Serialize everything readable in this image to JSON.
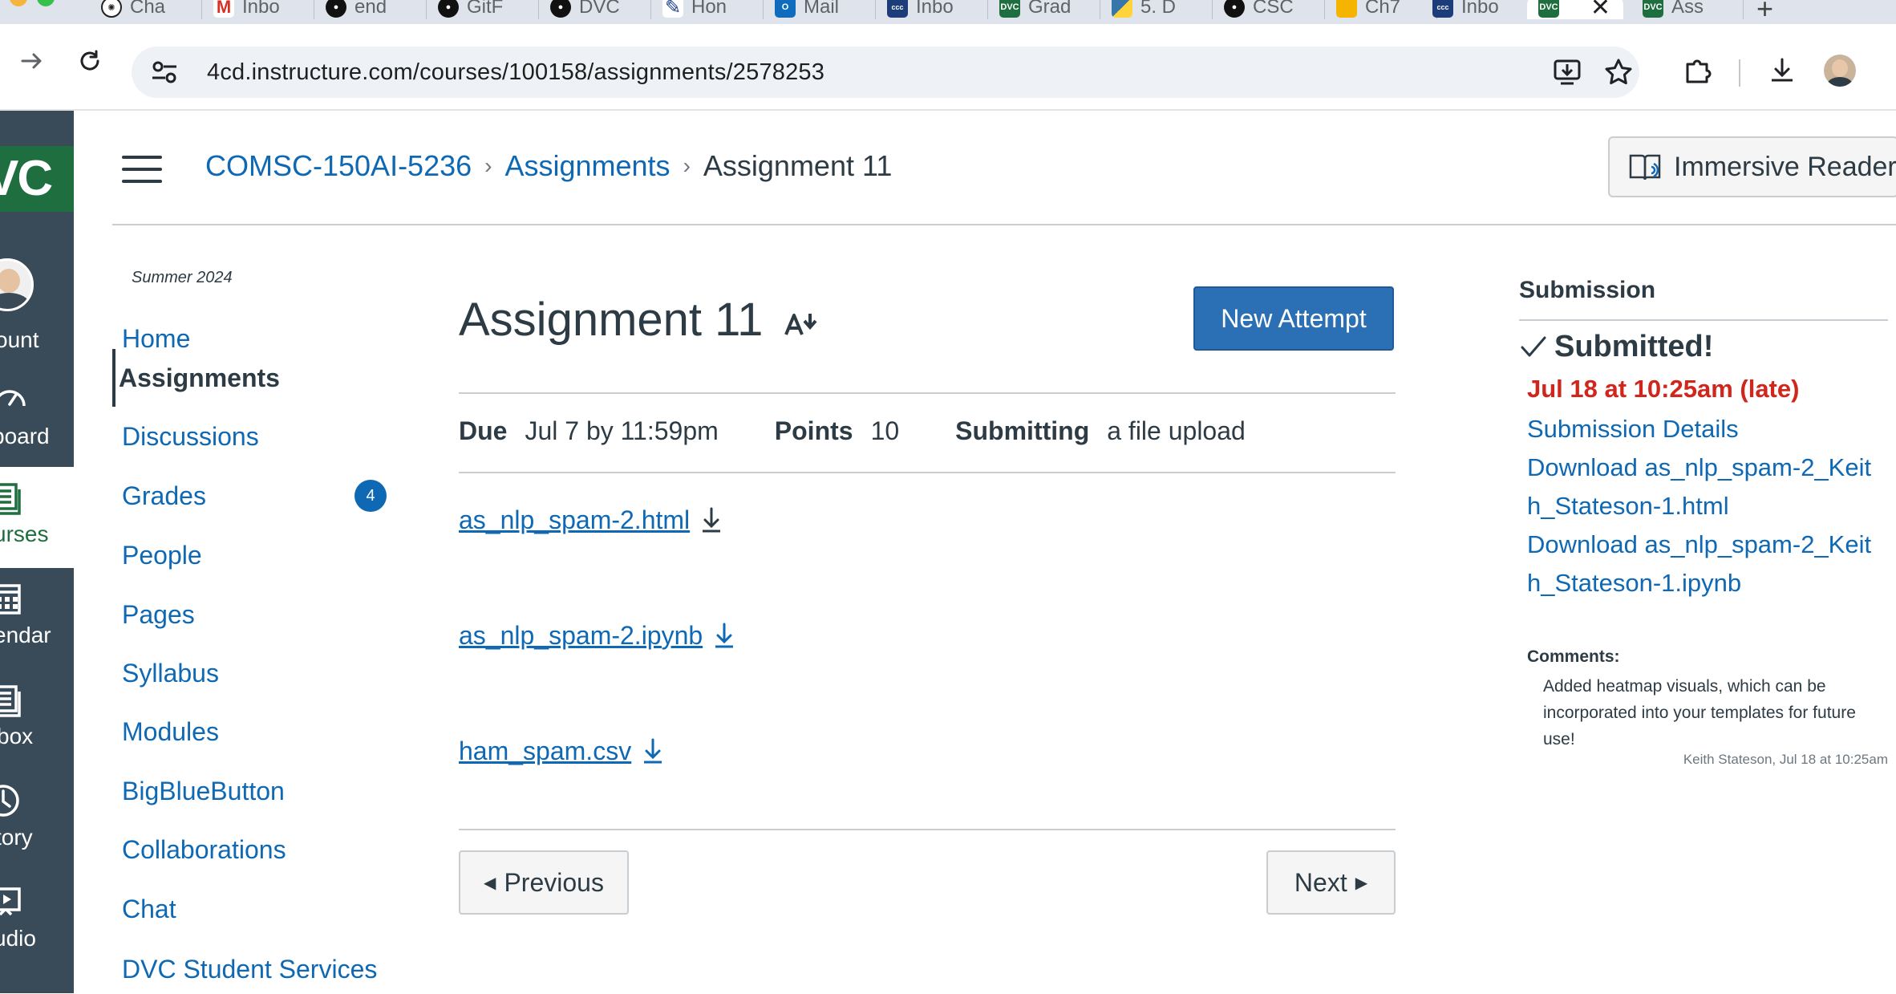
{
  "browser": {
    "tabs": [
      {
        "label": "Cha",
        "icon": "openai-icon"
      },
      {
        "label": "Inbo",
        "icon": "gmail-icon"
      },
      {
        "label": "end",
        "icon": "github-icon"
      },
      {
        "label": "GitF",
        "icon": "github-icon"
      },
      {
        "label": "DVC",
        "icon": "github-icon"
      },
      {
        "label": "Hon",
        "icon": "canvas-pen-icon"
      },
      {
        "label": "Mail",
        "icon": "outlook-icon"
      },
      {
        "label": "Inbo",
        "icon": "ccc-icon"
      },
      {
        "label": "Grad",
        "icon": "dvc-icon"
      },
      {
        "label": "5. D",
        "icon": "python-icon"
      },
      {
        "label": "CSC",
        "icon": "github-icon"
      },
      {
        "label": "Ch7",
        "icon": "slides-icon"
      },
      {
        "label": "Inbo",
        "icon": "ccc-icon"
      },
      {
        "label": "",
        "icon": "dvc-icon"
      },
      {
        "label": "Ass",
        "icon": "dvc-icon"
      }
    ],
    "url": "4cd.instructure.com/courses/100158/assignments/2578253"
  },
  "global_nav": {
    "logo_text": "VC",
    "items": [
      {
        "label": "ount",
        "icon": "avatar-icon"
      },
      {
        "label": "board",
        "icon": "dashboard-icon"
      },
      {
        "label": "urses",
        "icon": "courses-icon"
      },
      {
        "label": "endar",
        "icon": "calendar-icon"
      },
      {
        "label": "box",
        "icon": "inbox-icon"
      },
      {
        "label": "tory",
        "icon": "history-icon"
      },
      {
        "label": "udio",
        "icon": "studio-icon"
      }
    ]
  },
  "breadcrumbs": {
    "course": "COMSC-150AI-5236",
    "section": "Assignments",
    "current": "Assignment 11"
  },
  "immersive_reader_label": "Immersive Reader",
  "course_nav": {
    "term": "Summer 2024",
    "items": [
      {
        "label": "Home"
      },
      {
        "label": "Assignments"
      },
      {
        "label": "Discussions"
      },
      {
        "label": "Grades",
        "badge": "4"
      },
      {
        "label": "People"
      },
      {
        "label": "Pages"
      },
      {
        "label": "Syllabus"
      },
      {
        "label": "Modules"
      },
      {
        "label": "BigBlueButton"
      },
      {
        "label": "Collaborations"
      },
      {
        "label": "Chat"
      },
      {
        "label": "DVC Student Services"
      }
    ]
  },
  "assignment": {
    "title": "Assignment 11",
    "new_attempt_label": "New Attempt",
    "due_label": "Due",
    "due_value": "Jul 7 by 11:59pm",
    "points_label": "Points",
    "points_value": "10",
    "submitting_label": "Submitting",
    "submitting_value": "a file upload",
    "files": [
      "as_nlp_spam-2.html",
      "as_nlp_spam-2.ipynb",
      "ham_spam.csv"
    ],
    "previous_label": "Previous",
    "next_label": "Next"
  },
  "submission": {
    "heading": "Submission",
    "status": "Submitted!",
    "submitted_at": "Jul 18 at 10:25am (late)",
    "details_link": "Submission Details",
    "download_1": "Download as_nlp_spam-2_Keith_Stateson-1.html",
    "download_2": "Download as_nlp_spam-2_Keith_Stateson-1.ipynb",
    "comments_label": "Comments:",
    "comment_text": "Added heatmap visuals, which can be incorporated into your templates for future use!",
    "comment_meta": "Keith Stateson, Jul 18 at 10:25am"
  },
  "colors": {
    "brand_green": "#1e6e3f",
    "nav_dark": "#394b58",
    "link_blue": "#0e68b3",
    "primary_button": "#2b6fb4",
    "late_red": "#d0261c"
  }
}
